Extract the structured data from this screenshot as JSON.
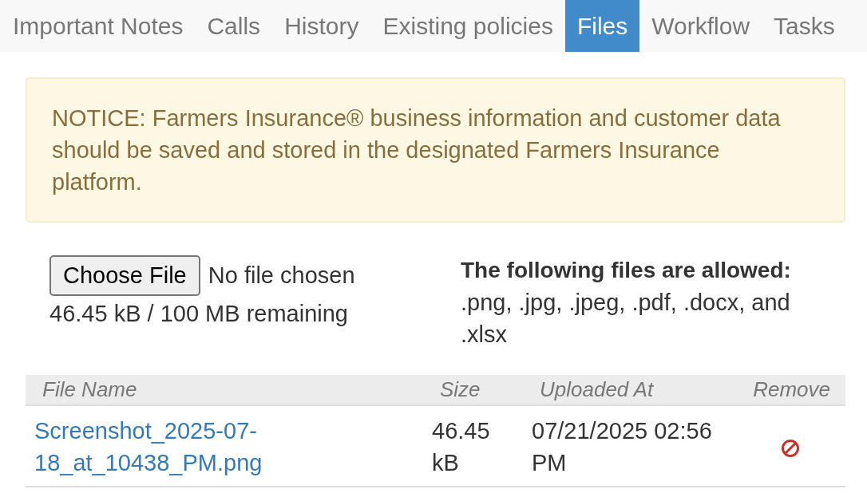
{
  "tabs": [
    {
      "label": "Important Notes",
      "selected": false
    },
    {
      "label": "Calls",
      "selected": false
    },
    {
      "label": "History",
      "selected": false
    },
    {
      "label": "Existing policies",
      "selected": false
    },
    {
      "label": "Files",
      "selected": true
    },
    {
      "label": "Workflow",
      "selected": false
    },
    {
      "label": "Tasks",
      "selected": false
    }
  ],
  "notice": {
    "text": "NOTICE: Farmers Insurance® business information and customer data should be saved and stored in the designated Farmers Insurance platform."
  },
  "upload": {
    "button_label": "Choose File",
    "file_status": "No file chosen",
    "quota": "46.45 kB / 100 MB remaining"
  },
  "allowed_types": {
    "heading": "The following files are allowed:",
    "list": ".png, .jpg, .jpeg, .pdf, .docx, and .xlsx"
  },
  "files_table": {
    "columns": [
      "File Name",
      "Size",
      "Uploaded At",
      "Remove"
    ],
    "rows": [
      {
        "file_name": "Screenshot_2025-07-18_at_10438_PM.png",
        "size": "46.45 kB",
        "uploaded_at": "07/21/2025 02:56 PM"
      }
    ]
  }
}
